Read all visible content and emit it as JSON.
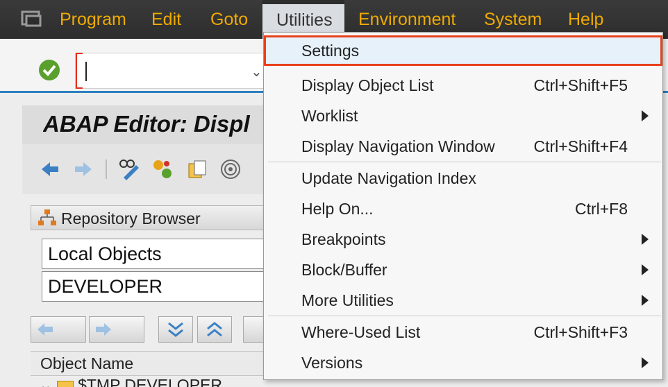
{
  "menubar": {
    "items": [
      {
        "label": "Program"
      },
      {
        "label": "Edit"
      },
      {
        "label": "Goto"
      },
      {
        "label": "Utilities"
      },
      {
        "label": "Environment"
      },
      {
        "label": "System"
      },
      {
        "label": "Help"
      }
    ]
  },
  "command": {
    "value": ""
  },
  "title": {
    "text": "ABAP Editor: Displ"
  },
  "repository": {
    "header": "Repository Browser",
    "object_type": "Local Objects",
    "user": "DEVELOPER",
    "column_header": "Object Name",
    "tree_first_row": "$TMP DEVELOPER"
  },
  "dropdown": {
    "items": [
      {
        "label": "Settings",
        "shortcut": "",
        "submenu": false
      },
      {
        "label": "Display Object List",
        "shortcut": "Ctrl+Shift+F5",
        "submenu": false
      },
      {
        "label": "Worklist",
        "shortcut": "",
        "submenu": true
      },
      {
        "label": "Display Navigation Window",
        "shortcut": "Ctrl+Shift+F4",
        "submenu": false
      },
      {
        "label": "Update Navigation Index",
        "shortcut": "",
        "submenu": false
      },
      {
        "label": "Help On...",
        "shortcut": "Ctrl+F8",
        "submenu": false
      },
      {
        "label": "Breakpoints",
        "shortcut": "",
        "submenu": true
      },
      {
        "label": "Block/Buffer",
        "shortcut": "",
        "submenu": true
      },
      {
        "label": "More Utilities",
        "shortcut": "",
        "submenu": true
      },
      {
        "label": "Where-Used List",
        "shortcut": "Ctrl+Shift+F3",
        "submenu": false
      },
      {
        "label": "Versions",
        "shortcut": "",
        "submenu": true
      }
    ]
  },
  "colors": {
    "menubar_bg": "#2d2d2d",
    "menu_text": "#f0ab00",
    "highlight_border": "#e8401c",
    "accent_line": "#2d7fc1"
  }
}
